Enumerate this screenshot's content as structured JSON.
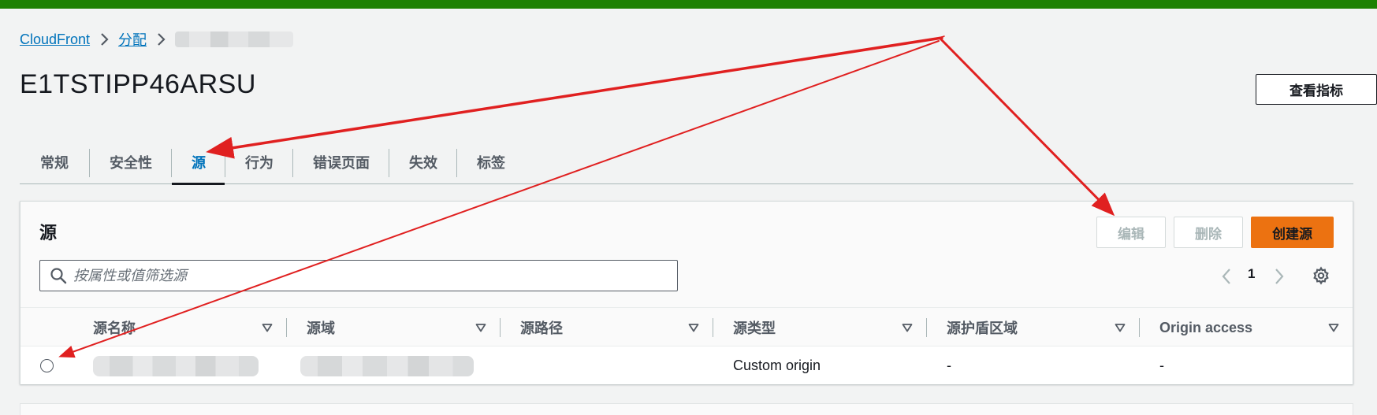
{
  "breadcrumb": {
    "items": [
      {
        "label": "CloudFront"
      },
      {
        "label": "分配"
      }
    ]
  },
  "page": {
    "title": "E1TSTIPP46ARSU",
    "view_metrics_label": "查看指标"
  },
  "tabs": [
    {
      "label": "常规"
    },
    {
      "label": "安全性"
    },
    {
      "label": "源",
      "active": true
    },
    {
      "label": "行为"
    },
    {
      "label": "错误页面"
    },
    {
      "label": "失效"
    },
    {
      "label": "标签"
    }
  ],
  "origins_panel": {
    "title": "源",
    "edit_label": "编辑",
    "delete_label": "删除",
    "create_label": "创建源",
    "search_placeholder": "按属性或值筛选源",
    "current_page": "1",
    "columns": [
      {
        "label": "源名称"
      },
      {
        "label": "源域"
      },
      {
        "label": "源路径"
      },
      {
        "label": "源类型"
      },
      {
        "label": "源护盾区域"
      },
      {
        "label": "Origin access"
      }
    ],
    "rows": [
      {
        "origin_path": "",
        "origin_type": "Custom origin",
        "shield_region": "-",
        "origin_access": "-"
      }
    ]
  },
  "colors": {
    "top_bar": "#1d8102",
    "link": "#0073bb",
    "primary_button": "#ec7211",
    "annotation_arrow": "#e02020"
  },
  "icons": {
    "breadcrumb_separator": "chevron-right-icon",
    "search": "search-icon",
    "pager_prev": "chevron-left-icon",
    "pager_next": "chevron-right-icon",
    "settings": "gear-icon",
    "sort": "caret-down-icon"
  }
}
